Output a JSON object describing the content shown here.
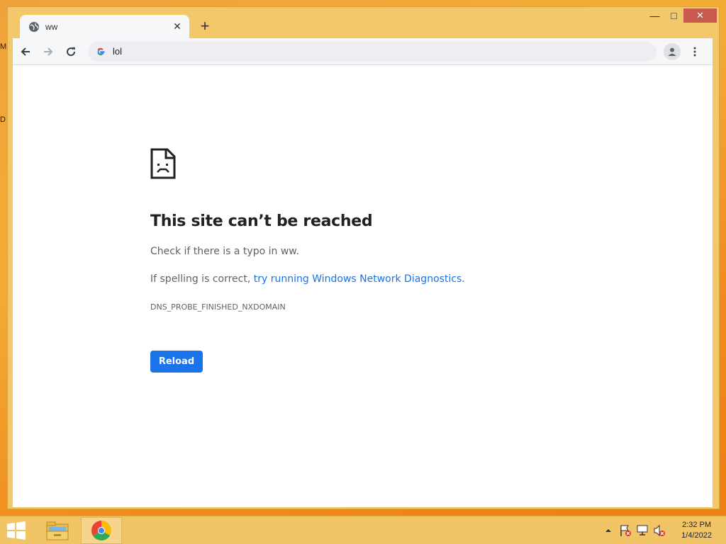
{
  "desktop": {
    "icon_label_1": "M",
    "icon_label_2": "D"
  },
  "window": {
    "minimize": "—",
    "maximize": "□",
    "close": "✕"
  },
  "tab": {
    "title": "ww",
    "close": "✕",
    "new_tab": "+"
  },
  "toolbar": {
    "url": "lol"
  },
  "error_page": {
    "heading": "This site can’t be reached",
    "line1": "Check if there is a typo in ww.",
    "line2_prefix": "If spelling is correct, ",
    "line2_link": "try running Windows Network Diagnostics",
    "line2_suffix": ".",
    "error_code": "DNS_PROBE_FINISHED_NXDOMAIN",
    "reload_label": "Reload"
  },
  "taskbar": {
    "time": "2:32 PM",
    "date": "1/4/2022"
  },
  "colors": {
    "accent": "#1a73e8",
    "window_frame": "#f3c86a",
    "close_button": "#c8594c"
  }
}
